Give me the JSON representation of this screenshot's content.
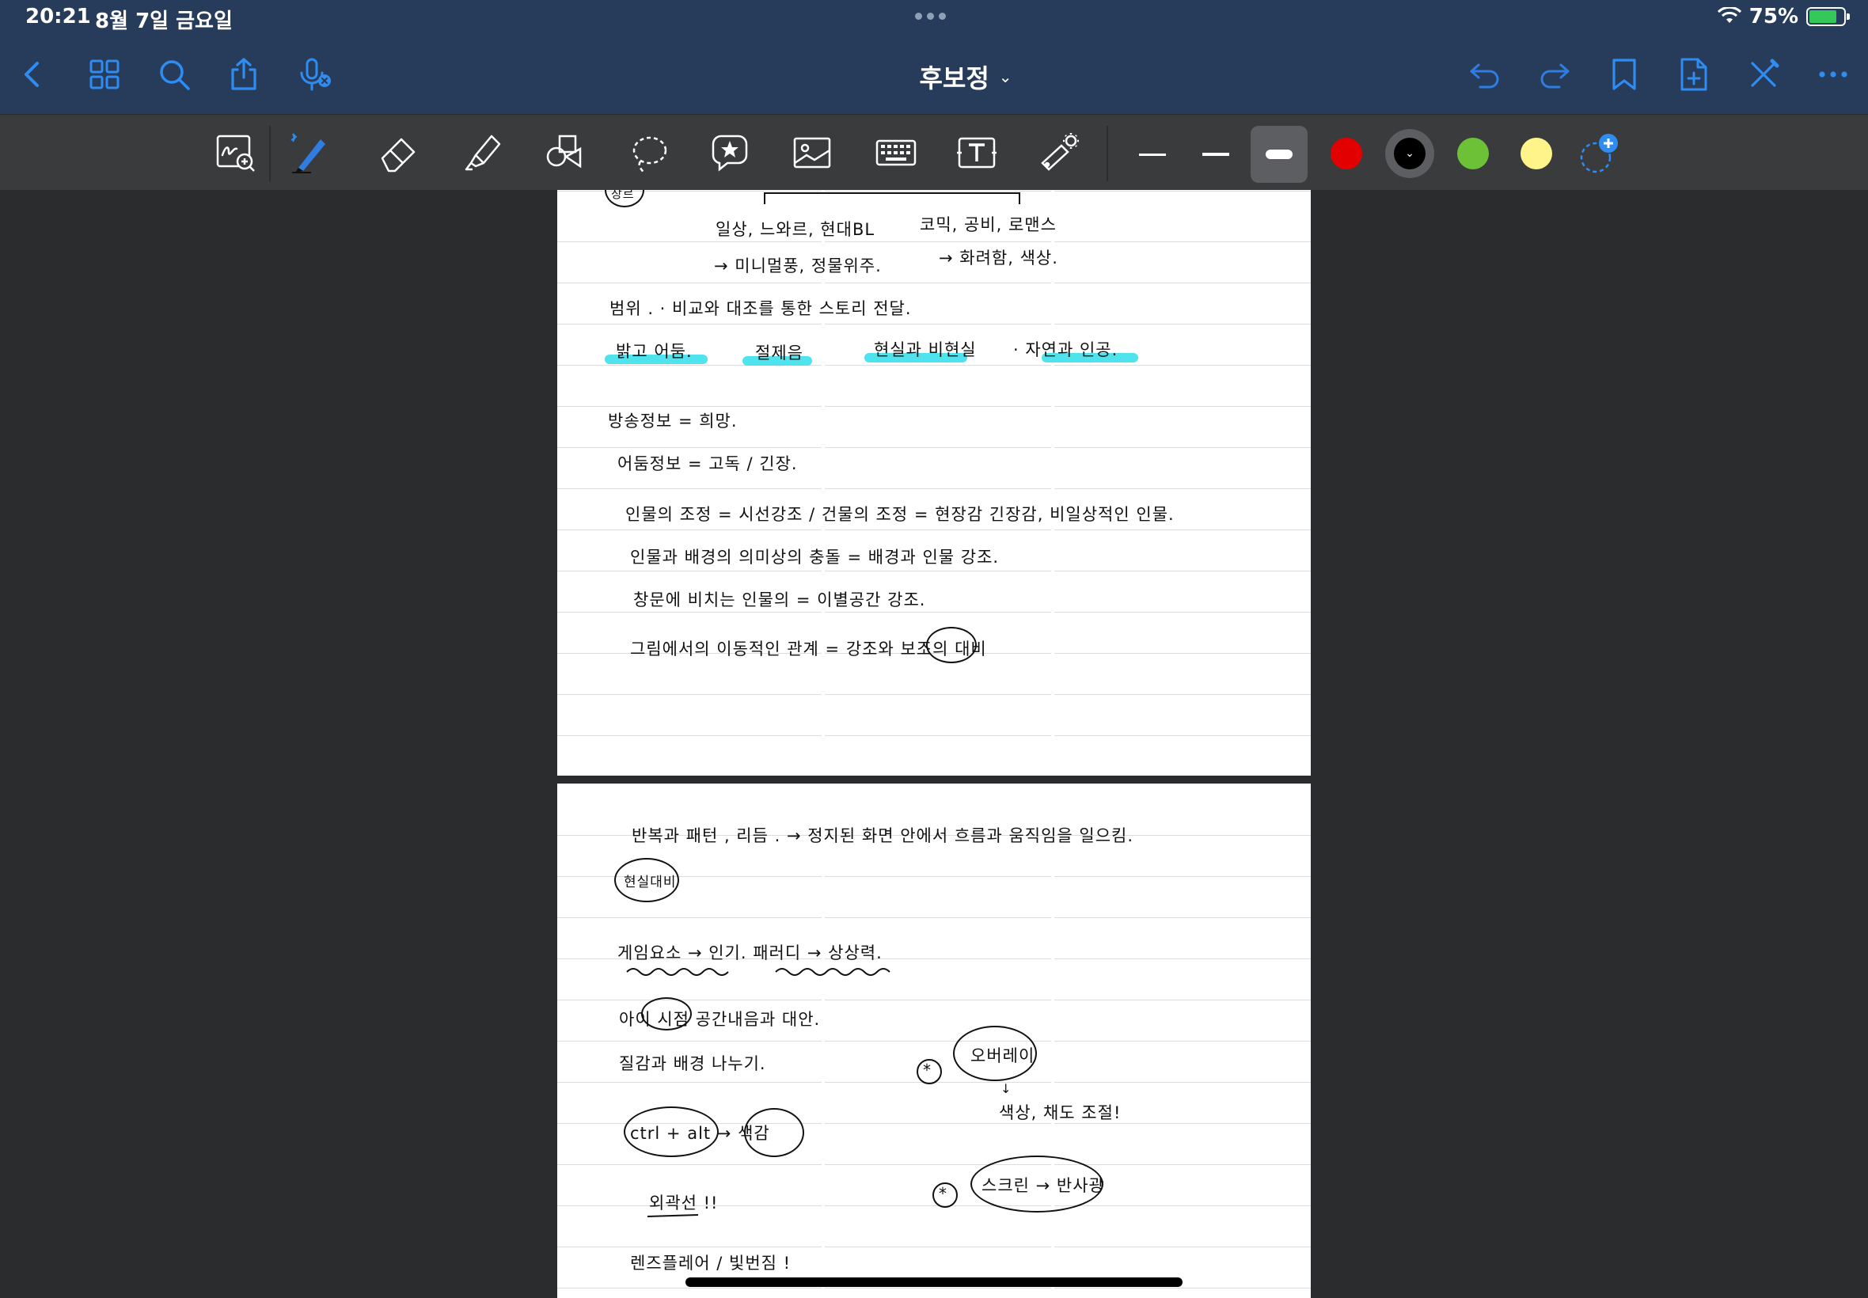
{
  "status": {
    "time": "20:21",
    "date": "8월 7일 금요일",
    "battery": "75%"
  },
  "nav": {
    "title": "후보정",
    "title_chevron": "⌄"
  },
  "toolbar": {
    "accent": "#2f7de0",
    "colors": [
      "#e30000",
      "#000000",
      "#6cc137",
      "#fff48a"
    ],
    "selected_color": "#000000"
  },
  "page1": {
    "lines": [
      "일상, 느와르, 현대BL",
      "→ 미니멀풍, 정물위주.",
      "코믹, 공비, 로맨스",
      "→ 화려함, 색상.",
      "범위 .  · 비교와 대조를 통한  스토리 전달.",
      "밝고 어둠.",
      "절제음",
      "현실과 비현실",
      "· 자연과 인공.",
      "방송정보 = 희망.",
      "어둠정보 = 고독 / 긴장.",
      "인물의 조정 = 시선강조  /  건물의 조정 = 현장감 긴장감, 비일상적인 인물.",
      "인물과 배경의 의미상의 충돌  =  배경과 인물 강조.",
      "창문에 비치는 인물의 = 이별공간 강조.",
      "그림에서의  이동적인 관계 =  강조와 보조의 대비"
    ],
    "circled": "장르"
  },
  "page2": {
    "lines": [
      "반복과 패턴 , 리듬 .  →  정지된 화면 안에서  흐름과 움직임을 일으킴.",
      "현실대비",
      "게임요소 → 인기.  패러디 → 상상력.",
      "아이 시점  공간내음과 대안.",
      "질감과 배경 나누기.",
      "오버레이",
      "색상, 채도 조절!",
      "ctrl + alt  →  색감",
      "스크린 → 반사광",
      "외곽선 !!",
      "렌즈플레어 / 빛번짐 !"
    ]
  }
}
